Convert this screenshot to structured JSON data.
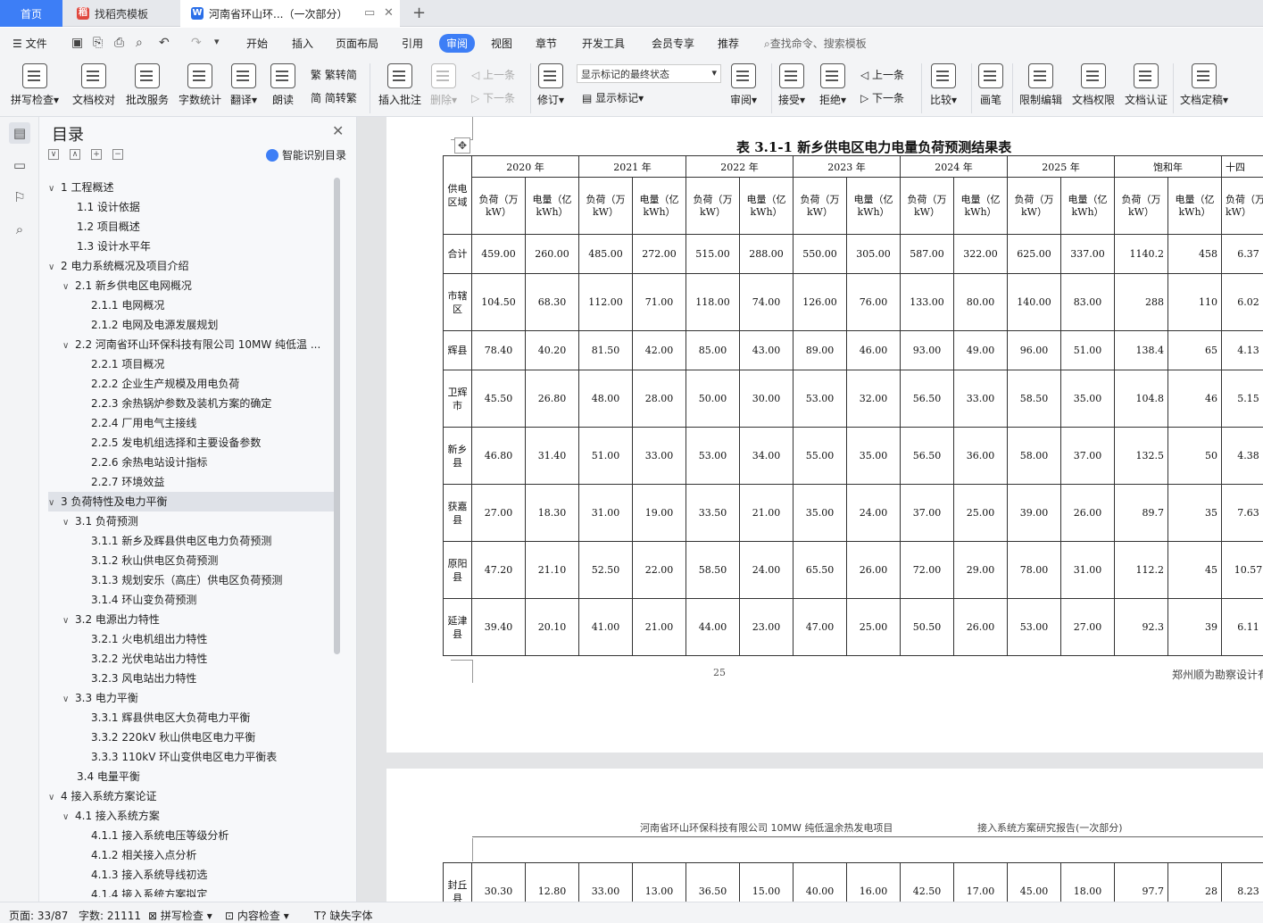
{
  "tabs": {
    "home": "首页",
    "template": "找稻壳模板",
    "doc": "河南省环山环...（一次部分）"
  },
  "menu": {
    "file": "文件",
    "items": [
      "开始",
      "插入",
      "页面布局",
      "引用",
      "审阅",
      "视图",
      "章节",
      "开发工具",
      "会员专享",
      "推荐"
    ],
    "search": "查找命令、搜索模板"
  },
  "ribbon": {
    "spell": "拼写检查",
    "proofread": "文档校对",
    "annotate_service": "批改服务",
    "wordcount": "字数统计",
    "translate": "翻译",
    "read": "朗读",
    "trad_to_simp": "繁转简",
    "simp_to_trad": "简转繁",
    "insert_comment": "插入批注",
    "delete": "删除",
    "prev_comment": "上一条",
    "next_comment": "下一条",
    "track": "修订",
    "markup_state": "显示标记的最终状态",
    "show_markup": "显示标记",
    "review": "审阅",
    "accept": "接受",
    "reject": "拒绝",
    "prev": "上一条",
    "next": "下一条",
    "compare": "比较",
    "pen": "画笔",
    "restrict": "限制编辑",
    "permission": "文档权限",
    "certify": "文档认证",
    "finalize": "文档定稿"
  },
  "toc": {
    "title": "目录",
    "smart": "智能识别目录",
    "items": [
      {
        "text": "1 工程概述",
        "level": 1,
        "caret": "∨"
      },
      {
        "text": "1.1  设计依据",
        "level": 2,
        "caret": ""
      },
      {
        "text": "1.2  项目概述",
        "level": 2,
        "caret": ""
      },
      {
        "text": "1.3  设计水平年",
        "level": 2,
        "caret": ""
      },
      {
        "text": "2  电力系统概况及项目介绍",
        "level": 1,
        "caret": "∨"
      },
      {
        "text": "2.1  新乡供电区电网概况",
        "level": 2,
        "caret": "∨"
      },
      {
        "text": "2.1.1  电网概况",
        "level": 3,
        "caret": ""
      },
      {
        "text": "2.1.2  电网及电源发展规划",
        "level": 3,
        "caret": ""
      },
      {
        "text": "2.2  河南省环山环保科技有限公司 10MW 纯低温 ...",
        "level": 2,
        "caret": "∨"
      },
      {
        "text": "2.2.1  项目概况",
        "level": 3,
        "caret": ""
      },
      {
        "text": "2.2.2  企业生产规模及用电负荷",
        "level": 3,
        "caret": ""
      },
      {
        "text": "2.2.3  余热锅炉参数及装机方案的确定",
        "level": 3,
        "caret": ""
      },
      {
        "text": "2.2.4  厂用电气主接线",
        "level": 3,
        "caret": ""
      },
      {
        "text": "2.2.5  发电机组选择和主要设备参数",
        "level": 3,
        "caret": ""
      },
      {
        "text": "2.2.6  余热电站设计指标",
        "level": 3,
        "caret": ""
      },
      {
        "text": "2.2.7  环境效益",
        "level": 3,
        "caret": ""
      },
      {
        "text": "3 负荷特性及电力平衡",
        "level": 1,
        "caret": "∨",
        "selected": true
      },
      {
        "text": "3.1 负荷预测",
        "level": 2,
        "caret": "∨"
      },
      {
        "text": "3.1.1 新乡及辉县供电区电力负荷预测",
        "level": 3,
        "caret": ""
      },
      {
        "text": "3.1.2 秋山供电区负荷预测",
        "level": 3,
        "caret": ""
      },
      {
        "text": "3.1.3 规划安乐（高庄）供电区负荷预测",
        "level": 3,
        "caret": ""
      },
      {
        "text": "3.1.4  环山变负荷预测",
        "level": 3,
        "caret": ""
      },
      {
        "text": "3.2  电源出力特性",
        "level": 2,
        "caret": "∨"
      },
      {
        "text": "3.2.1  火电机组出力特性",
        "level": 3,
        "caret": ""
      },
      {
        "text": "3.2.2  光伏电站出力特性",
        "level": 3,
        "caret": ""
      },
      {
        "text": "3.2.3  风电站出力特性",
        "level": 3,
        "caret": ""
      },
      {
        "text": "3.3 电力平衡",
        "level": 2,
        "caret": "∨"
      },
      {
        "text": "3.3.1  辉县供电区大负荷电力平衡",
        "level": 3,
        "caret": ""
      },
      {
        "text": "3.3.2 220kV 秋山供电区电力平衡",
        "level": 3,
        "caret": ""
      },
      {
        "text": "3.3.3 110kV 环山变供电区电力平衡表",
        "level": 3,
        "caret": ""
      },
      {
        "text": "3.4  电量平衡",
        "level": 2,
        "caret": ""
      },
      {
        "text": "4  接入系统方案论证",
        "level": 1,
        "caret": "∨"
      },
      {
        "text": "4.1  接入系统方案",
        "level": 2,
        "caret": "∨"
      },
      {
        "text": "4.1.1  接入系统电压等级分析",
        "level": 3,
        "caret": ""
      },
      {
        "text": "4.1.2  相关接入点分析",
        "level": 3,
        "caret": ""
      },
      {
        "text": "4.1.3  接入系统导线初选",
        "level": 3,
        "caret": ""
      },
      {
        "text": "4.1.4  接入系统方案拟定",
        "level": 3,
        "caret": ""
      }
    ]
  },
  "doc": {
    "table_title": "表 3.1-1 新乡供电区电力电量负荷预测结果表",
    "corner": "供电区域",
    "years": [
      "2020 年",
      "2021 年",
      "2022 年",
      "2023 年",
      "2024 年",
      "2025 年",
      "饱和年",
      "十四"
    ],
    "sub_load": "负荷（万kW）",
    "sub_energy": "电量（亿kWh）",
    "sub_load_cut": "负荷（万kW）",
    "rows": [
      {
        "region": "合计",
        "vals": [
          "459.00",
          "260.00",
          "485.00",
          "272.00",
          "515.00",
          "288.00",
          "550.00",
          "305.00",
          "587.00",
          "322.00",
          "625.00",
          "337.00",
          "1140.2",
          "458",
          "6.37"
        ]
      },
      {
        "region": "市辖区",
        "vals": [
          "104.50",
          "68.30",
          "112.00",
          "71.00",
          "118.00",
          "74.00",
          "126.00",
          "76.00",
          "133.00",
          "80.00",
          "140.00",
          "83.00",
          "288",
          "110",
          "6.02"
        ]
      },
      {
        "region": "辉县",
        "vals": [
          "78.40",
          "40.20",
          "81.50",
          "42.00",
          "85.00",
          "43.00",
          "89.00",
          "46.00",
          "93.00",
          "49.00",
          "96.00",
          "51.00",
          "138.4",
          "65",
          "4.13"
        ]
      },
      {
        "region": "卫辉市",
        "vals": [
          "45.50",
          "26.80",
          "48.00",
          "28.00",
          "50.00",
          "30.00",
          "53.00",
          "32.00",
          "56.50",
          "33.00",
          "58.50",
          "35.00",
          "104.8",
          "46",
          "5.15"
        ]
      },
      {
        "region": "新乡县",
        "vals": [
          "46.80",
          "31.40",
          "51.00",
          "33.00",
          "53.00",
          "34.00",
          "55.00",
          "35.00",
          "56.50",
          "36.00",
          "58.00",
          "37.00",
          "132.5",
          "50",
          "4.38"
        ]
      },
      {
        "region": "获嘉县",
        "vals": [
          "27.00",
          "18.30",
          "31.00",
          "19.00",
          "33.50",
          "21.00",
          "35.00",
          "24.00",
          "37.00",
          "25.00",
          "39.00",
          "26.00",
          "89.7",
          "35",
          "7.63"
        ]
      },
      {
        "region": "原阳县",
        "vals": [
          "47.20",
          "21.10",
          "52.50",
          "22.00",
          "58.50",
          "24.00",
          "65.50",
          "26.00",
          "72.00",
          "29.00",
          "78.00",
          "31.00",
          "112.2",
          "45",
          "10.57"
        ]
      },
      {
        "region": "延津县",
        "vals": [
          "39.40",
          "20.10",
          "41.00",
          "21.00",
          "44.00",
          "23.00",
          "47.00",
          "25.00",
          "50.50",
          "26.00",
          "53.00",
          "27.00",
          "92.3",
          "39",
          "6.11"
        ]
      }
    ],
    "page_number": "25",
    "footer_company": "郑州顺为勘察设计有",
    "page2_header_left": "河南省环山环保科技有限公司 10MW 纯低温余热发电项目",
    "page2_header_right": "接入系统方案研究报告(一次部分)",
    "page2_row": {
      "region": "封丘县",
      "vals": [
        "30.30",
        "12.80",
        "33.00",
        "13.00",
        "36.50",
        "15.00",
        "40.00",
        "16.00",
        "42.50",
        "17.00",
        "45.00",
        "18.00",
        "97.7",
        "28",
        "8.23"
      ]
    }
  },
  "status": {
    "page": "页面: 33/87",
    "words": "字数: 21111",
    "spell": "拼写检查",
    "content": "内容检查",
    "missing_font": "缺失字体"
  }
}
